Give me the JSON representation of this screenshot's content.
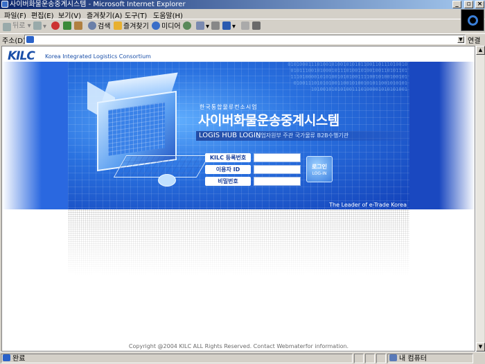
{
  "window": {
    "title": "사이버화물운송중계시스템 - Microsoft Internet Explorer"
  },
  "menu": [
    "파일(F)",
    "편집(E)",
    "보기(V)",
    "즐겨찾기(A)",
    "도구(T)",
    "도움말(H)"
  ],
  "toolbar": {
    "back": "뒤로",
    "search": "검색",
    "favorites": "즐겨찾기",
    "media": "미디어"
  },
  "address": {
    "label": "주소(D)",
    "value": "",
    "go": "연결"
  },
  "site": {
    "logo": "KILC",
    "logo_sub": "Korea Integrated Logistics Consortium",
    "binary_text": "01010001110100101001010101100110111010010 0101110010100010111010010100100110101101 1110100001010100101010011110010100100101 010011101010100110010100101011001010101 101001010101001110100001010101001",
    "pre_title": "한국통합물류컨소시엄",
    "title": "사이버화물운송중계시스템",
    "login_strip_title": "LOGIS HUB LOGIN",
    "login_strip_sub": "산업자원부 주관 국가물류 B2B수행기관",
    "fields": {
      "kilc_no_label": "KILC 등록번호",
      "user_id_label": "이용자 ID",
      "password_label": "비밀번호"
    },
    "login_button_ko": "로그인",
    "login_button_en": "LOG-IN",
    "tagline": "The Leader of e-Trade Korea",
    "copyright": "Copyright @2004 KILC ALL Rights Reserved. Contact Webmaterfor information."
  },
  "status": {
    "left": "완료",
    "zone": "내 컴퓨터"
  }
}
